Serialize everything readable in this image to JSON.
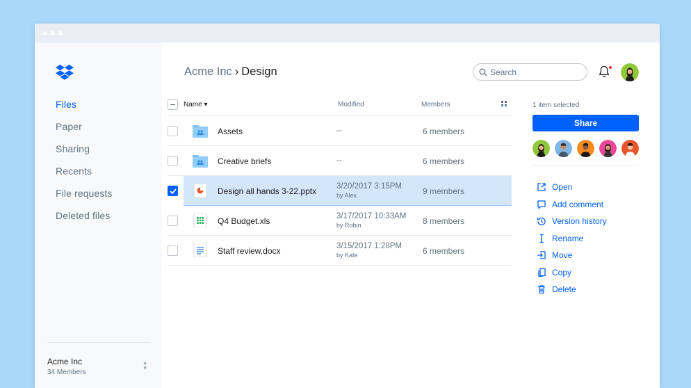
{
  "sidebar": {
    "nav": [
      "Files",
      "Paper",
      "Sharing",
      "Recents",
      "File requests",
      "Deleted files"
    ],
    "team": {
      "name": "Acme Inc",
      "members": "34 Members"
    }
  },
  "header": {
    "breadcrumb": {
      "parent": "Acme Inc",
      "separator": "›",
      "current": "Design"
    },
    "search_placeholder": "Search"
  },
  "table": {
    "columns": {
      "name": "Name ▾",
      "modified": "Modified",
      "members": "Members"
    },
    "rows": [
      {
        "icon": "folder-shared-icon",
        "name": "Assets",
        "modified": "--",
        "by": "",
        "members": "6 members",
        "selected": false
      },
      {
        "icon": "folder-shared-icon",
        "name": "Creative briefs",
        "modified": "--",
        "by": "",
        "members": "6 members",
        "selected": false
      },
      {
        "icon": "presentation-file-icon",
        "name": "Design all hands 3-22.pptx",
        "modified": "3/20/2017 3:15PM",
        "by": "by Alex",
        "members": "9 members",
        "selected": true
      },
      {
        "icon": "spreadsheet-file-icon",
        "name": "Q4 Budget.xls",
        "modified": "3/17/2017 10:33AM",
        "by": "by Robin",
        "members": "8 members",
        "selected": false
      },
      {
        "icon": "document-file-icon",
        "name": "Staff review.docx",
        "modified": "3/15/2017 1:28PM",
        "by": "by Kate",
        "members": "6 members",
        "selected": false
      }
    ]
  },
  "panel": {
    "selected_count": "1 item selected",
    "share_label": "Share",
    "actions": [
      {
        "icon": "open-icon",
        "label": "Open"
      },
      {
        "icon": "comment-icon",
        "label": "Add comment"
      },
      {
        "icon": "history-icon",
        "label": "Version history"
      },
      {
        "icon": "rename-icon",
        "label": "Rename"
      },
      {
        "icon": "move-icon",
        "label": "Move"
      },
      {
        "icon": "copy-icon",
        "label": "Copy"
      },
      {
        "icon": "trash-icon",
        "label": "Delete"
      }
    ]
  },
  "colors": {
    "accent": "#0061fe",
    "selection": "#d4e6f9",
    "background": "#a9d8fb"
  }
}
